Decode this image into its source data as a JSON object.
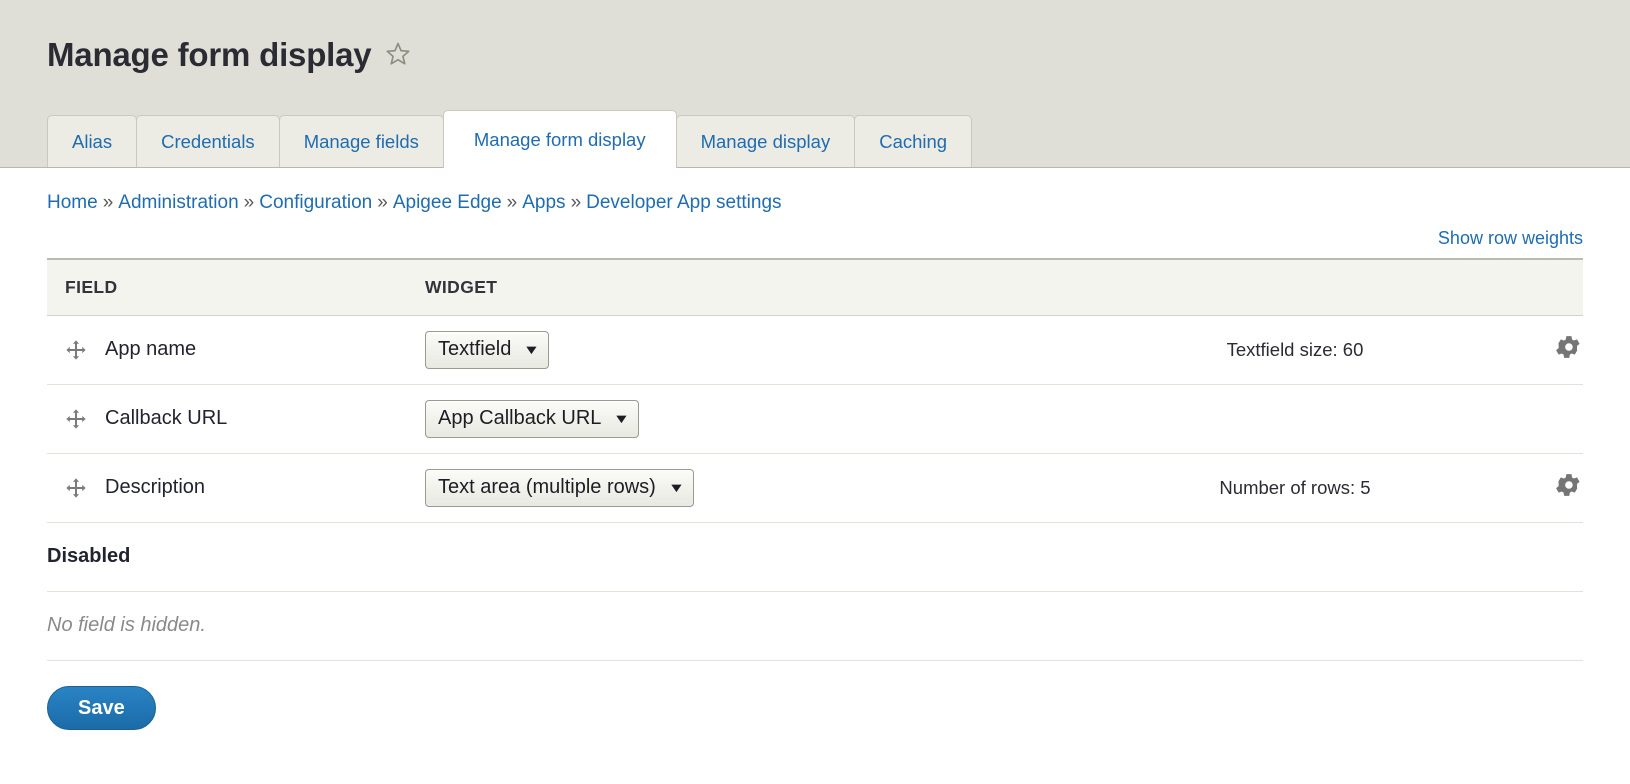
{
  "header": {
    "title": "Manage form display",
    "star_icon": "star-outline-icon"
  },
  "tabs": [
    {
      "label": "Alias",
      "active": false
    },
    {
      "label": "Credentials",
      "active": false
    },
    {
      "label": "Manage fields",
      "active": false
    },
    {
      "label": "Manage form display",
      "active": true
    },
    {
      "label": "Manage display",
      "active": false
    },
    {
      "label": "Caching",
      "active": false
    }
  ],
  "breadcrumb": {
    "separator": "»",
    "items": [
      "Home",
      "Administration",
      "Configuration",
      "Apigee Edge",
      "Apps",
      "Developer App settings"
    ]
  },
  "toolbar": {
    "show_row_weights_label": "Show row weights"
  },
  "table": {
    "columns": [
      "FIELD",
      "WIDGET"
    ],
    "rows": [
      {
        "drag_icon": "move-handle-icon",
        "field": "App name",
        "widget": "Textfield",
        "summary": "Textfield size: 60",
        "settings_icon": "gear-icon",
        "has_settings": true
      },
      {
        "drag_icon": "move-handle-icon",
        "field": "Callback URL",
        "widget": "App Callback URL",
        "summary": "",
        "settings_icon": "",
        "has_settings": false
      },
      {
        "drag_icon": "move-handle-icon",
        "field": "Description",
        "widget": "Text area (multiple rows)",
        "summary": "Number of rows: 5",
        "settings_icon": "gear-icon",
        "has_settings": true
      }
    ],
    "disabled_region_label": "Disabled",
    "empty_message": "No field is hidden."
  },
  "actions": {
    "save_label": "Save"
  },
  "colors": {
    "link": "#1f6cb0",
    "header_band": "#dfdfd7",
    "table_head": "#f4f4ee",
    "primary_button": "#1f76b8"
  }
}
